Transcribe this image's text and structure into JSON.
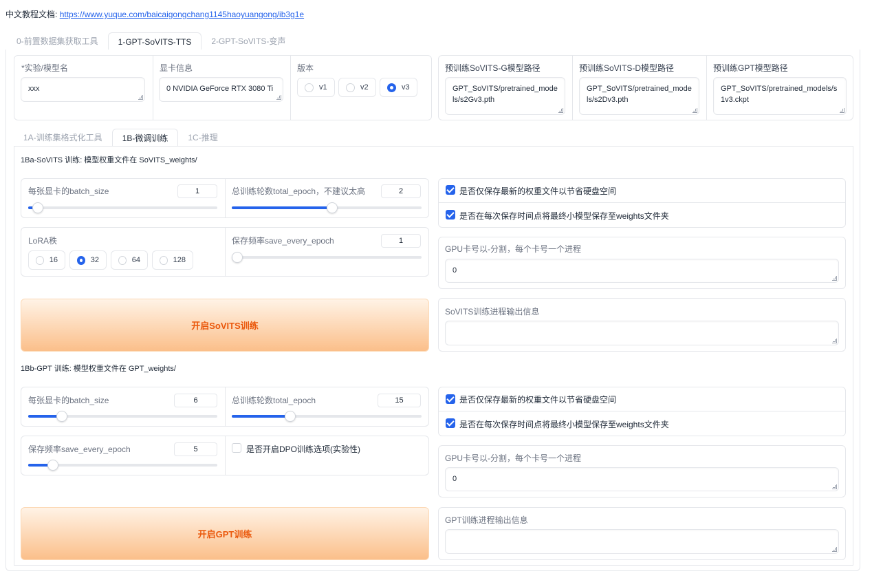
{
  "header": {
    "doc_label": "中文教程文档:",
    "doc_link": "https://www.yuque.com/baicaigongchang1145haoyuangong/ib3g1e"
  },
  "main_tabs": [
    "0-前置数据集获取工具",
    "1-GPT-SoVITS-TTS",
    "2-GPT-SoVITS-变声"
  ],
  "model_row": {
    "exp_name_label": "*实验/模型名",
    "exp_name_value": "xxx",
    "gpu_info_label": "显卡信息",
    "gpu_info_value": "0 NVIDIA GeForce RTX 3080 Ti",
    "version_label": "版本",
    "versions": [
      "v1",
      "v2",
      "v3"
    ],
    "version_selected": "v3",
    "sovits_g_label": "预训练SoVITS-G模型路径",
    "sovits_g_value": "GPT_SoVITS/pretrained_models/s2Gv3.pth",
    "sovits_d_label": "预训练SoVITS-D模型路径",
    "sovits_d_value": "GPT_SoVITS/pretrained_models/s2Dv3.pth",
    "gpt_label": "预训练GPT模型路径",
    "gpt_value": "GPT_SoVITS/pretrained_models/s1v3.ckpt"
  },
  "sub_tabs": [
    "1A-训练集格式化工具",
    "1B-微调训练",
    "1C-推理"
  ],
  "sovits": {
    "title": "1Ba-SoVITS 训练: 模型权重文件在 SoVITS_weights/",
    "batch_label": "每张显卡的batch_size",
    "batch_value": "1",
    "batch_fraction": 0.02,
    "epoch_label": "总训练轮数total_epoch，不建议太高",
    "epoch_value": "2",
    "epoch_fraction": 0.5,
    "lora_label": "LoRA秩",
    "lora_options": [
      "16",
      "32",
      "64",
      "128"
    ],
    "lora_selected": "32",
    "save_label": "保存频率save_every_epoch",
    "save_value": "1",
    "save_fraction": 0.0,
    "chk_latest": "是否仅保存最新的权重文件以节省硬盘空间",
    "chk_latest_on": true,
    "chk_small": "是否在每次保存时间点将最终小模型保存至weights文件夹",
    "chk_small_on": true,
    "gpu_ids_label": "GPU卡号以-分割，每个卡号一个进程",
    "gpu_ids_value": "0",
    "button": "开启SoVITS训练",
    "output_label": "SoVITS训练进程输出信息",
    "output_value": ""
  },
  "gpt": {
    "title": "1Bb-GPT 训练: 模型权重文件在 GPT_weights/",
    "batch_label": "每张显卡的batch_size",
    "batch_value": "6",
    "batch_fraction": 0.15,
    "epoch_label": "总训练轮数total_epoch",
    "epoch_value": "15",
    "epoch_fraction": 0.28,
    "save_label": "保存频率save_every_epoch",
    "save_value": "5",
    "save_fraction": 0.1,
    "dpo_label": "是否开启DPO训练选项(实验性)",
    "dpo_on": false,
    "chk_latest": "是否仅保存最新的权重文件以节省硬盘空间",
    "chk_latest_on": true,
    "chk_small": "是否在每次保存时间点将最终小模型保存至weights文件夹",
    "chk_small_on": true,
    "gpu_ids_label": "GPU卡号以-分割，每个卡号一个进程",
    "gpu_ids_value": "0",
    "button": "开启GPT训练",
    "output_label": "GPT训练进程输出信息",
    "output_value": ""
  }
}
